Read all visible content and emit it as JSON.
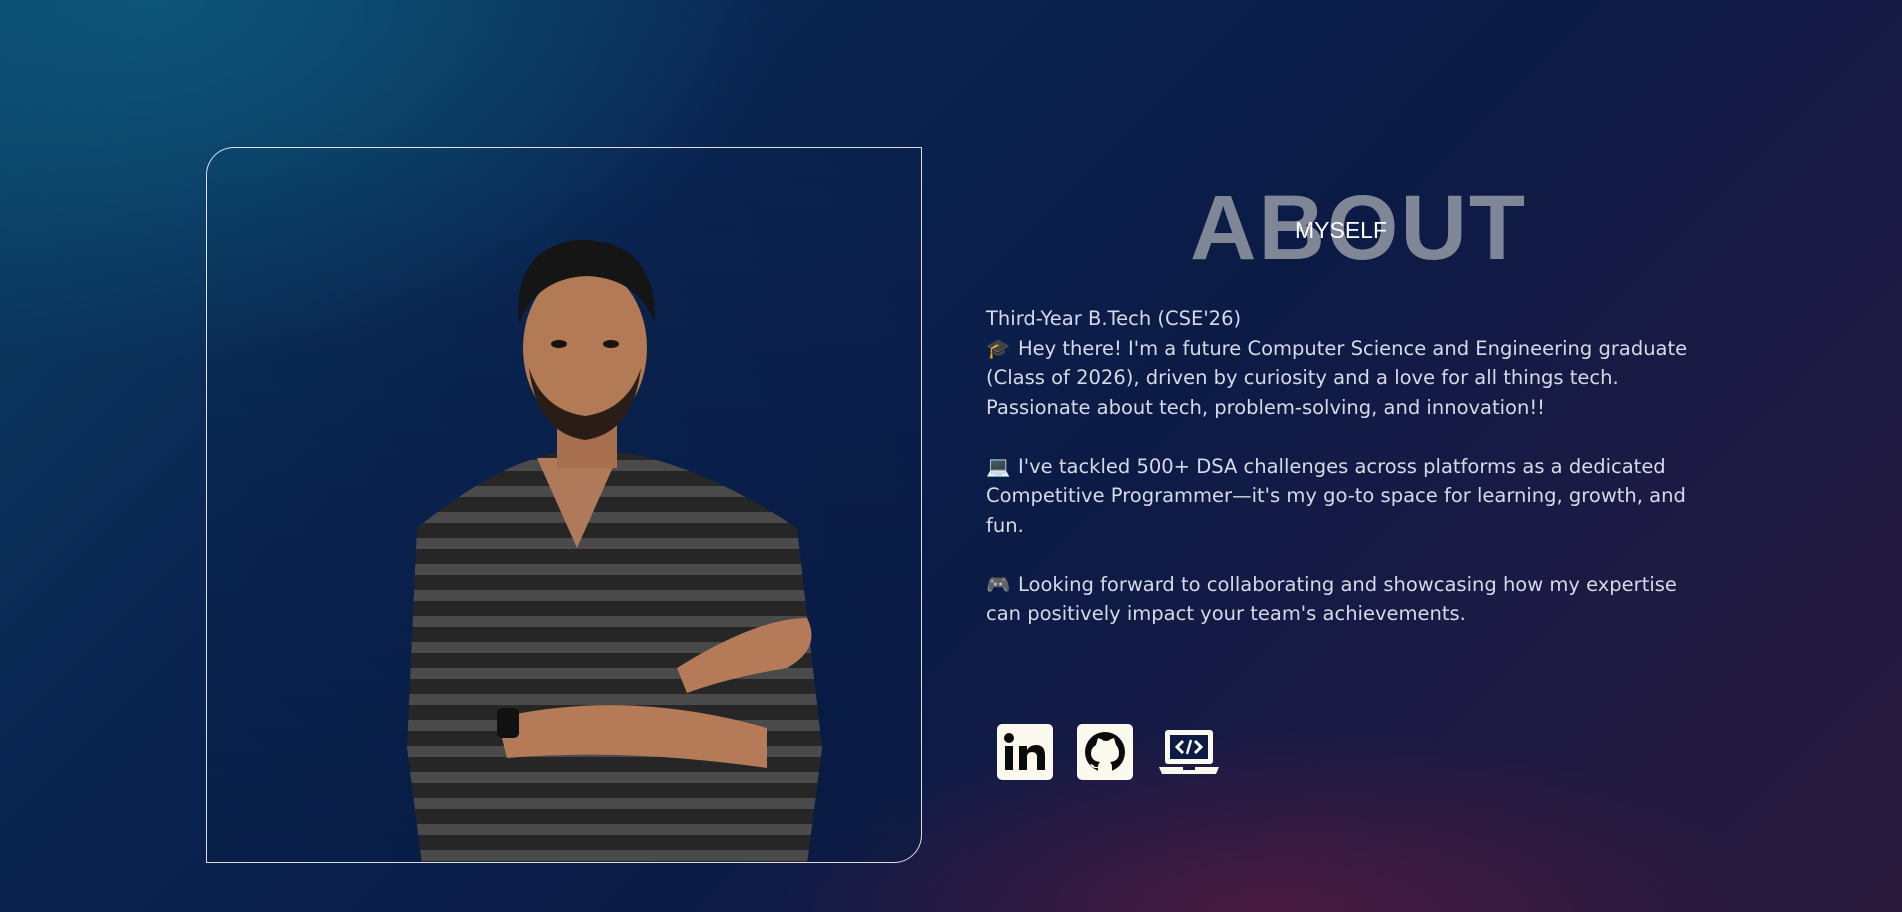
{
  "about": {
    "heading_big": "ABOUT",
    "heading_small": "MYSELF",
    "subtitle": "Third-Year B.Tech (CSE'26)",
    "paragraphs": [
      {
        "icon": "graduation-cap-icon",
        "emoji": "🎓",
        "text": "Hey there! I'm a future Computer Science and Engineering graduate (Class of 2026), driven by curiosity and a love for all things tech. Passionate about tech, problem-solving, and innovation!!"
      },
      {
        "icon": "laptop-icon",
        "emoji": "💻",
        "text": "I've tackled 500+ DSA challenges across platforms as a dedicated Competitive Programmer—it's my go-to space for learning, growth, and fun."
      },
      {
        "icon": "game-controller-icon",
        "emoji": "🎮",
        "text": "Looking forward to collaborating and showcasing how my expertise can positively impact your team's achievements."
      }
    ]
  },
  "social": [
    {
      "name": "linkedin-icon"
    },
    {
      "name": "github-icon"
    },
    {
      "name": "coding-profile-icon"
    }
  ],
  "colors": {
    "heading_big": "#7f8796",
    "body_text": "#d6dae6",
    "icon_fill": "#fbf9ee",
    "frame_border": "#ffffff"
  }
}
